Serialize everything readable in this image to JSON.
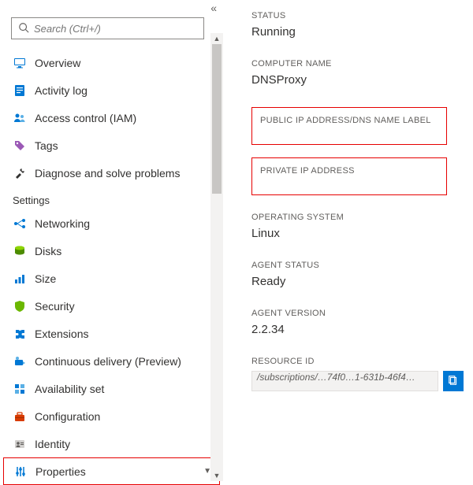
{
  "search": {
    "placeholder": "Search (Ctrl+/)"
  },
  "nav": {
    "overview": "Overview",
    "activity_log": "Activity log",
    "access_control": "Access control (IAM)",
    "tags": "Tags",
    "diagnose": "Diagnose and solve problems",
    "settings_header": "Settings",
    "networking": "Networking",
    "disks": "Disks",
    "size": "Size",
    "security": "Security",
    "extensions": "Extensions",
    "continuous_delivery": "Continuous delivery (Preview)",
    "availability_set": "Availability set",
    "configuration": "Configuration",
    "identity": "Identity",
    "properties": "Properties"
  },
  "details": {
    "status_label": "STATUS",
    "status_value": "Running",
    "computer_name_label": "COMPUTER NAME",
    "computer_name_value": "DNSProxy",
    "public_ip_label": "PUBLIC IP ADDRESS/DNS NAME LABEL",
    "private_ip_label": "PRIVATE IP ADDRESS",
    "os_label": "OPERATING SYSTEM",
    "os_value": "Linux",
    "agent_status_label": "AGENT STATUS",
    "agent_status_value": "Ready",
    "agent_version_label": "AGENT VERSION",
    "agent_version_value": "2.2.34",
    "resource_id_label": "RESOURCE ID",
    "resource_id_value": "/subscriptions/…74f0…1-631b-46f4…"
  }
}
